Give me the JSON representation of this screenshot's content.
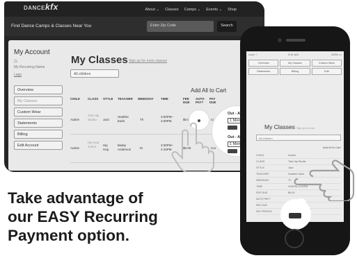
{
  "desktop": {
    "logo": {
      "small": "DANCE",
      "big": "kfx"
    },
    "nav": [
      "About ⌄",
      "Classes",
      "Camps ⌄",
      "Events ⌄",
      "Shop"
    ],
    "search_caption": "Find Dance Camps & Classes Near You",
    "zip_placeholder": "Enter Zip Code",
    "search_button": "Search",
    "account": {
      "title": "My Account",
      "home_icon": "home-icon",
      "user_line1": "My Recurring Name",
      "user_line2": "Logo",
      "menu": [
        "Overview",
        "My Classes",
        "Custom Wear",
        "Statements",
        "Billing",
        "Edit Account"
      ]
    },
    "classes": {
      "title": "My Classes",
      "link": "Sign up for more classes",
      "filter": "All children",
      "add_all": "Add All to Cart",
      "headers": [
        "CHILD",
        "CLASS",
        "STYLE",
        "TEACHER",
        "WEEKDAY",
        "TIME",
        "FEE DUE",
        "AUTO PAY?",
        "PAY DUE"
      ],
      "rows": [
        {
          "child": "Aubrie",
          "class": "Tots Hip Studio",
          "style": "Jazz",
          "teacher": "Heather Earls",
          "weekday": "Th",
          "time": "3:00PM– 3:30PM",
          "fee": "$0.00",
          "pay_due": "Current",
          "out": "Out - A",
          "month": "1 Mon"
        },
        {
          "child": "Aubrie",
          "class": "Hip Hop Junior",
          "style": "Hip Hop",
          "teacher": "Bailey Anderson",
          "weekday": "M",
          "time": "3:30PM– 4:15PM",
          "fee": "$0.00",
          "pay_due": "Cur",
          "out": "Out - A",
          "month": "1 Mon"
        }
      ]
    }
  },
  "headline": [
    "Take advantage of",
    "our EASY Recurring",
    "Payment option."
  ],
  "phone": {
    "status_left": "•••oo ⌔",
    "status_time": "9:41 AM",
    "status_right": "100% ▭",
    "grid": [
      [
        "Overview",
        "My Classes",
        "Custom Wear"
      ],
      [
        "Statements",
        "Billing",
        "Edit"
      ]
    ],
    "title": "My Classes",
    "title_link": "Sign up for more",
    "filter": "All children",
    "add_all": "Add All to Cart",
    "details": [
      {
        "k": "CHILD",
        "v": "Aubrie"
      },
      {
        "k": "CLASS",
        "v": "Tots Hip Studio"
      },
      {
        "k": "STYLE",
        "v": "Jazz"
      },
      {
        "k": "TEACHER",
        "v": "Heather Earls"
      },
      {
        "k": "WEEKDAY",
        "v": "Th"
      },
      {
        "k": "TIME",
        "v": "3:00PM–3:30PM"
      },
      {
        "k": "FEE DUE",
        "v": "$0.00"
      },
      {
        "k": "AUTO PAY?",
        "v": ""
      },
      {
        "k": "PAY DUE",
        "v": "Current"
      },
      {
        "k": "PAY PERIOD",
        "v": "Out - A"
      }
    ]
  }
}
